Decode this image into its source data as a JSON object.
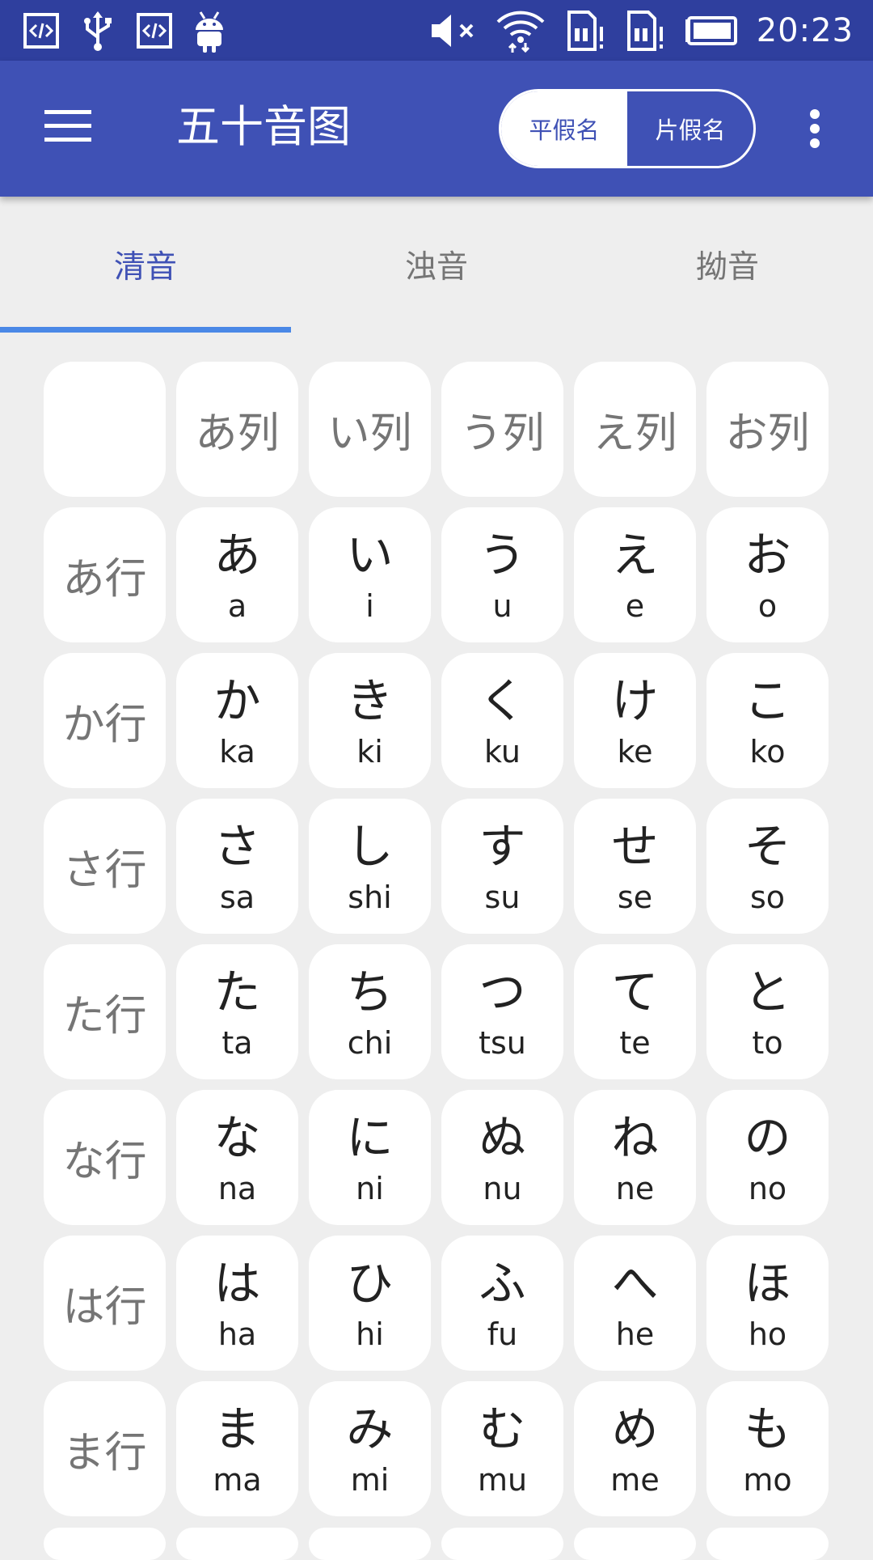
{
  "status_bar": {
    "time": "20:23",
    "left_icons": [
      "code-icon",
      "usb-icon",
      "code-icon",
      "android-icon"
    ],
    "right_icons": [
      "mute-icon",
      "wifi-icon",
      "sim-alert-icon",
      "sim-alert-icon",
      "battery-icon"
    ]
  },
  "app_bar": {
    "title": "五十音图",
    "toggle": {
      "options": [
        "平假名",
        "片假名"
      ],
      "selected": "平假名"
    }
  },
  "tabs": {
    "items": [
      "清音",
      "浊音",
      "拗音"
    ],
    "active": "清音"
  },
  "grid": {
    "column_headers": [
      "あ列",
      "い列",
      "う列",
      "え列",
      "お列"
    ],
    "rows": [
      {
        "header": "あ行",
        "cells": [
          {
            "kana": "あ",
            "romaji": "a"
          },
          {
            "kana": "い",
            "romaji": "i"
          },
          {
            "kana": "う",
            "romaji": "u"
          },
          {
            "kana": "え",
            "romaji": "e"
          },
          {
            "kana": "お",
            "romaji": "o"
          }
        ]
      },
      {
        "header": "か行",
        "cells": [
          {
            "kana": "か",
            "romaji": "ka"
          },
          {
            "kana": "き",
            "romaji": "ki"
          },
          {
            "kana": "く",
            "romaji": "ku"
          },
          {
            "kana": "け",
            "romaji": "ke"
          },
          {
            "kana": "こ",
            "romaji": "ko"
          }
        ]
      },
      {
        "header": "さ行",
        "cells": [
          {
            "kana": "さ",
            "romaji": "sa"
          },
          {
            "kana": "し",
            "romaji": "shi"
          },
          {
            "kana": "す",
            "romaji": "su"
          },
          {
            "kana": "せ",
            "romaji": "se"
          },
          {
            "kana": "そ",
            "romaji": "so"
          }
        ]
      },
      {
        "header": "た行",
        "cells": [
          {
            "kana": "た",
            "romaji": "ta"
          },
          {
            "kana": "ち",
            "romaji": "chi"
          },
          {
            "kana": "つ",
            "romaji": "tsu"
          },
          {
            "kana": "て",
            "romaji": "te"
          },
          {
            "kana": "と",
            "romaji": "to"
          }
        ]
      },
      {
        "header": "な行",
        "cells": [
          {
            "kana": "な",
            "romaji": "na"
          },
          {
            "kana": "に",
            "romaji": "ni"
          },
          {
            "kana": "ぬ",
            "romaji": "nu"
          },
          {
            "kana": "ね",
            "romaji": "ne"
          },
          {
            "kana": "の",
            "romaji": "no"
          }
        ]
      },
      {
        "header": "は行",
        "cells": [
          {
            "kana": "は",
            "romaji": "ha"
          },
          {
            "kana": "ひ",
            "romaji": "hi"
          },
          {
            "kana": "ふ",
            "romaji": "fu"
          },
          {
            "kana": "へ",
            "romaji": "he"
          },
          {
            "kana": "ほ",
            "romaji": "ho"
          }
        ]
      },
      {
        "header": "ま行",
        "cells": [
          {
            "kana": "ま",
            "romaji": "ma"
          },
          {
            "kana": "み",
            "romaji": "mi"
          },
          {
            "kana": "む",
            "romaji": "mu"
          },
          {
            "kana": "め",
            "romaji": "me"
          },
          {
            "kana": "も",
            "romaji": "mo"
          }
        ]
      }
    ]
  },
  "colors": {
    "status_bar": "#2f3f9e",
    "app_bar": "#3f51b5",
    "tab_indicator": "#4a88e6",
    "background": "#eeeeee",
    "cell": "#ffffff",
    "header_text": "#757575"
  }
}
